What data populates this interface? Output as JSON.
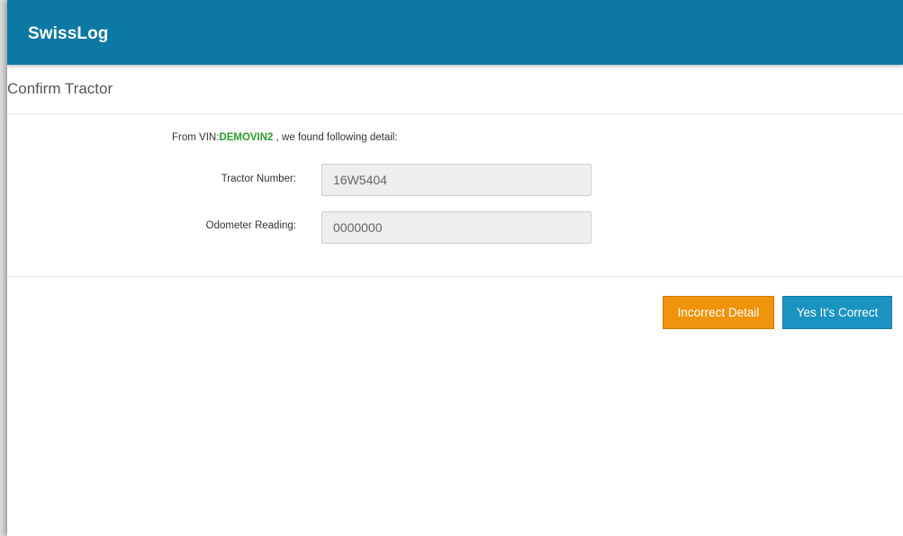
{
  "app": {
    "title": "SwissLog"
  },
  "page": {
    "title": "Confirm Tractor"
  },
  "details": {
    "intro_prefix": "From VIN:",
    "vin": "DEMOVIN2",
    "intro_suffix": " , we found following detail:",
    "tractor_number_label": "Tractor Number:",
    "tractor_number_value": "16W5404",
    "odometer_label": "Odometer Reading:",
    "odometer_value": "0000000"
  },
  "actions": {
    "incorrect_label": "Incorrect Detail",
    "correct_label": "Yes It's Correct"
  },
  "colors": {
    "appbar": "#0b79a3",
    "vin_highlight": "#2e9a2e",
    "incorrect_button": "#f0930a",
    "correct_button": "#1a93c0"
  }
}
